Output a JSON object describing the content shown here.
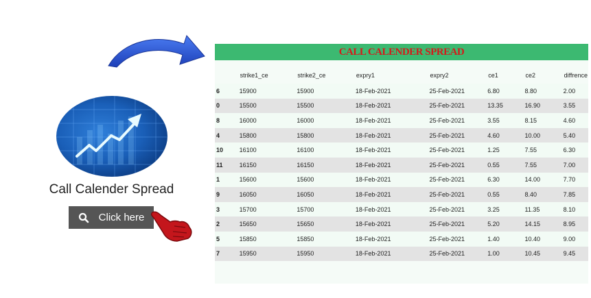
{
  "promo": {
    "title": "Call Calender Spread",
    "button_label": "Click here",
    "button_icon": "search-icon",
    "arrow_icon": "curved-arrow-icon",
    "pointer_icon": "pointing-hand-icon"
  },
  "table": {
    "title": "CALL CALENDER SPREAD",
    "header_color": "#3cb971",
    "title_color": "#d41a1a",
    "columns": [
      "",
      "strike1_ce",
      "strike2_ce",
      "expry1",
      "expry2",
      "ce1",
      "ce2",
      "diffrence"
    ],
    "rows": [
      [
        "6",
        "15900",
        "15900",
        "18-Feb-2021",
        "25-Feb-2021",
        "6.80",
        "8.80",
        "2.00"
      ],
      [
        "0",
        "15500",
        "15500",
        "18-Feb-2021",
        "25-Feb-2021",
        "13.35",
        "16.90",
        "3.55"
      ],
      [
        "8",
        "16000",
        "16000",
        "18-Feb-2021",
        "25-Feb-2021",
        "3.55",
        "8.15",
        "4.60"
      ],
      [
        "4",
        "15800",
        "15800",
        "18-Feb-2021",
        "25-Feb-2021",
        "4.60",
        "10.00",
        "5.40"
      ],
      [
        "10",
        "16100",
        "16100",
        "18-Feb-2021",
        "25-Feb-2021",
        "1.25",
        "7.55",
        "6.30"
      ],
      [
        "11",
        "16150",
        "16150",
        "18-Feb-2021",
        "25-Feb-2021",
        "0.55",
        "7.55",
        "7.00"
      ],
      [
        "1",
        "15600",
        "15600",
        "18-Feb-2021",
        "25-Feb-2021",
        "6.30",
        "14.00",
        "7.70"
      ],
      [
        "9",
        "16050",
        "16050",
        "18-Feb-2021",
        "25-Feb-2021",
        "0.55",
        "8.40",
        "7.85"
      ],
      [
        "3",
        "15700",
        "15700",
        "18-Feb-2021",
        "25-Feb-2021",
        "3.25",
        "11.35",
        "8.10"
      ],
      [
        "2",
        "15650",
        "15650",
        "18-Feb-2021",
        "25-Feb-2021",
        "5.20",
        "14.15",
        "8.95"
      ],
      [
        "5",
        "15850",
        "15850",
        "18-Feb-2021",
        "25-Feb-2021",
        "1.40",
        "10.40",
        "9.00"
      ],
      [
        "7",
        "15950",
        "15950",
        "18-Feb-2021",
        "25-Feb-2021",
        "1.00",
        "10.45",
        "9.45"
      ]
    ]
  }
}
